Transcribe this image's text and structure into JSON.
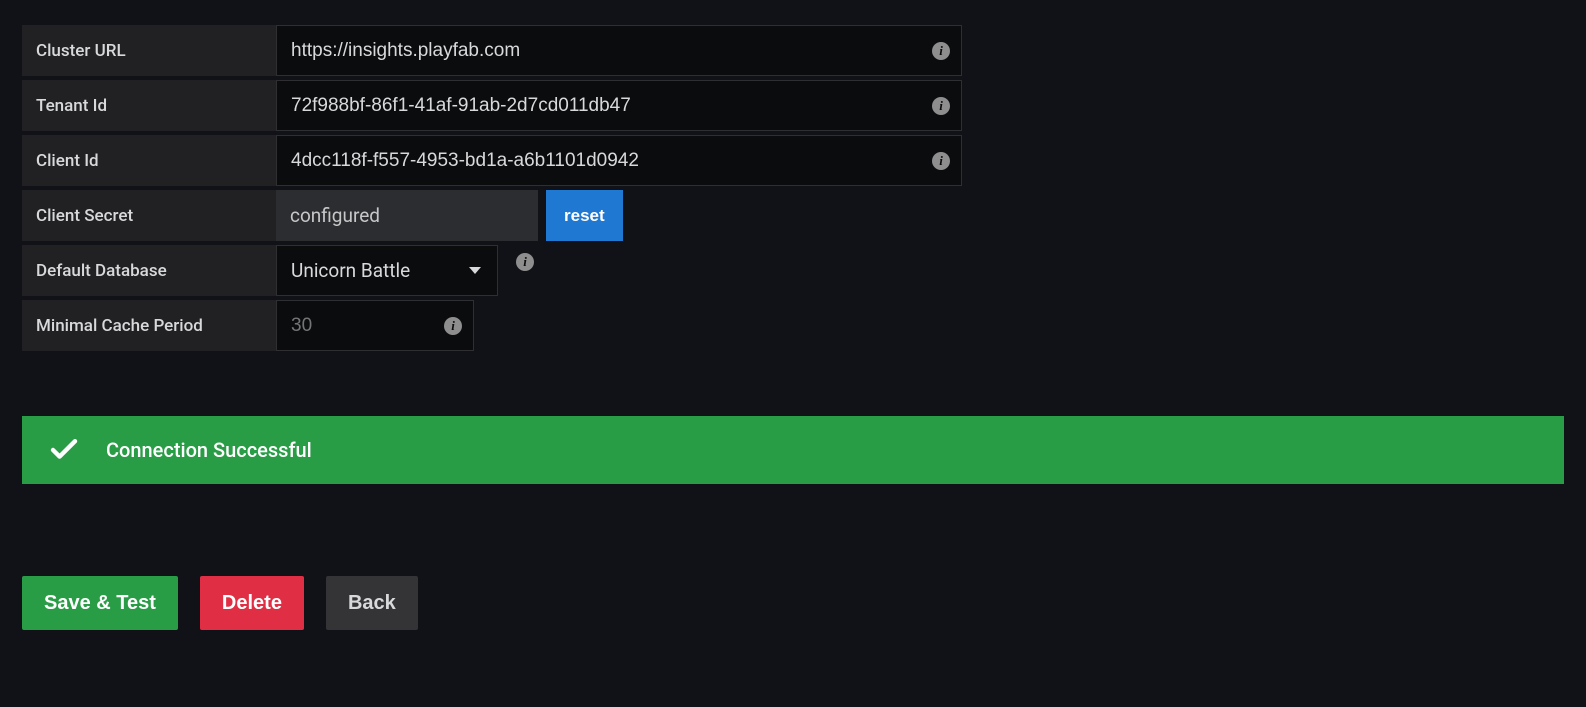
{
  "form": {
    "cluster_url": {
      "label": "Cluster URL",
      "value": "https://insights.playfab.com"
    },
    "tenant_id": {
      "label": "Tenant Id",
      "value": "72f988bf-86f1-41af-91ab-2d7cd011db47"
    },
    "client_id": {
      "label": "Client Id",
      "value": "4dcc118f-f557-4953-bd1a-a6b1101d0942"
    },
    "client_secret": {
      "label": "Client Secret",
      "status": "configured",
      "reset_label": "reset"
    },
    "default_database": {
      "label": "Default Database",
      "selected": "Unicorn Battle"
    },
    "minimal_cache_period": {
      "label": "Minimal Cache Period",
      "placeholder": "30"
    }
  },
  "alert": {
    "message": "Connection Successful"
  },
  "buttons": {
    "save_test": "Save & Test",
    "delete": "Delete",
    "back": "Back"
  }
}
